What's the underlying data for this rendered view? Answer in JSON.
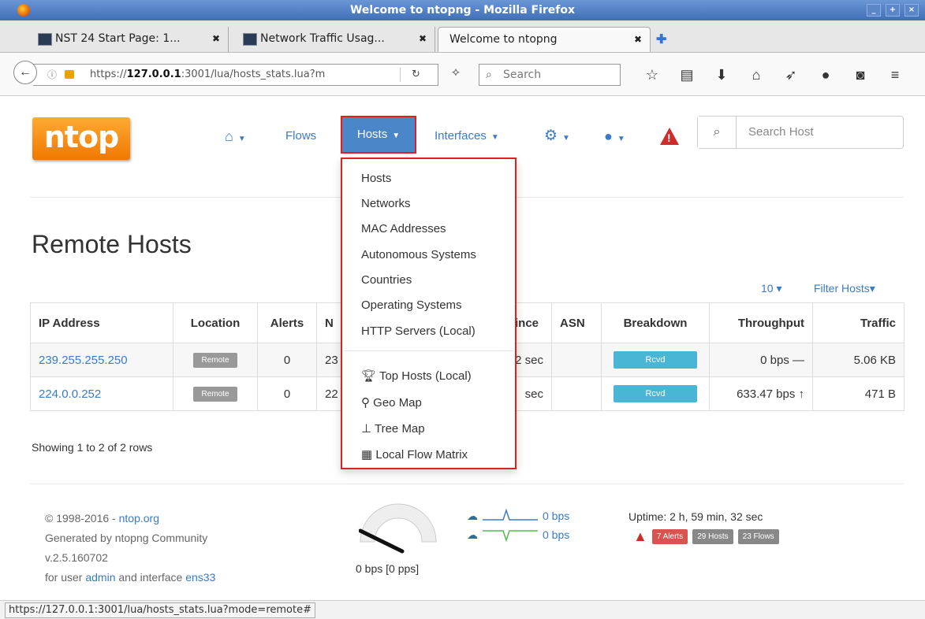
{
  "window": {
    "title": "Welcome to ntopng - Mozilla Firefox"
  },
  "tabs": [
    {
      "label": "NST 24 Start Page: 1..."
    },
    {
      "label": "Network Traffic Usag..."
    },
    {
      "label": "Welcome to ntopng"
    }
  ],
  "browser": {
    "url_prefix": "https://",
    "url_host": "127.0.0.1",
    "url_rest": ":3001/lua/hosts_stats.lua?m",
    "search_placeholder": "Search",
    "status_url": "https://127.0.0.1:3001/lua/hosts_stats.lua?mode=remote#"
  },
  "logo": "ntop",
  "nav": {
    "flows": "Flows",
    "hosts": "Hosts",
    "interfaces": "Interfaces",
    "search_placeholder": "Search Host"
  },
  "hosts_menu": {
    "items": [
      "Hosts",
      "Networks",
      "MAC Addresses",
      "Autonomous Systems",
      "Countries",
      "Operating Systems",
      "HTTP Servers (Local)"
    ],
    "extra": [
      "Top Hosts (Local)",
      "Geo Map",
      "Tree Map",
      "Local Flow Matrix"
    ]
  },
  "page": {
    "title": "Remote Hosts",
    "page_size": "10",
    "filter": "Filter Hosts"
  },
  "table": {
    "headers": [
      "IP Address",
      "Location",
      "Alerts",
      "N",
      "Since",
      "ASN",
      "Breakdown",
      "Throughput",
      "Traffic"
    ],
    "rows": [
      {
        "ip": "239.255.255.250",
        "location": "Remote",
        "alerts": "0",
        "n": "23",
        "since": "52 sec",
        "asn": "",
        "breakdown": "Rcvd",
        "throughput": "0 bps —",
        "traffic": "5.06 KB"
      },
      {
        "ip": "224.0.0.252",
        "location": "Remote",
        "alerts": "0",
        "n": "22",
        "since": "sec",
        "asn": "",
        "breakdown": "Rcvd",
        "throughput": "633.47 bps ↑",
        "traffic": "471 B"
      }
    ]
  },
  "showing": "Showing 1 to 2 of 2 rows",
  "footer": {
    "copyright_prefix": "© 1998-2016 - ",
    "copyright_link": "ntop.org",
    "generated": "Generated by ntopng Community",
    "version": "v.2.5.160702",
    "user_prefix": "for user ",
    "user": "admin",
    "iface_prefix": " and interface ",
    "iface": "ens33",
    "gauge_label": "0 bps [0 pps]",
    "upload_rate": "0 bps",
    "download_rate": "0 bps",
    "uptime": "Uptime: 2 h, 59 min, 32 sec",
    "badges": {
      "alerts": "7 Alerts",
      "hosts": "29 Hosts",
      "flows": "23 Flows"
    }
  },
  "colors": {
    "accent": "#3a7bc8",
    "hosts_button": "#4a86c8",
    "highlight_border": "#e02020",
    "alert": "#d02b2b",
    "rcvd_bar": "#49b6d6"
  }
}
